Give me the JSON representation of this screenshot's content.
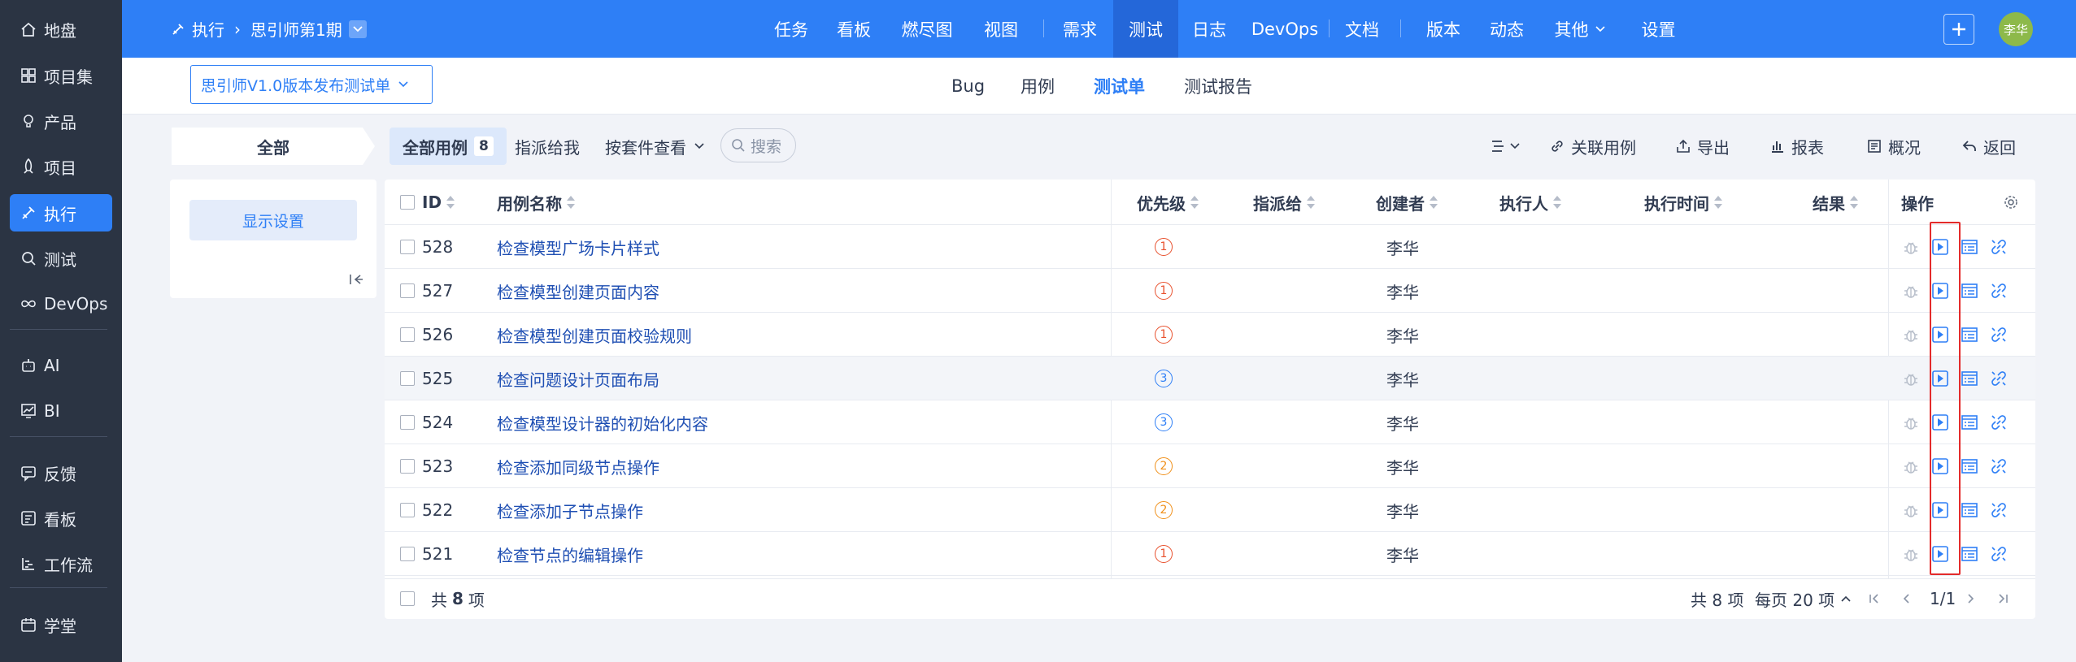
{
  "sidebar": {
    "items": [
      {
        "label": "地盘",
        "icon": "home-icon"
      },
      {
        "label": "项目集",
        "icon": "grid-icon"
      },
      {
        "label": "产品",
        "icon": "lightbulb-icon"
      },
      {
        "label": "项目",
        "icon": "rocket-icon"
      },
      {
        "label": "执行",
        "icon": "pen-icon",
        "active": true
      },
      {
        "label": "测试",
        "icon": "search-icon"
      },
      {
        "label": "DevOps",
        "icon": "infinity-icon"
      },
      {
        "label": "AI",
        "icon": "robot-icon"
      },
      {
        "label": "BI",
        "icon": "chart-icon"
      },
      {
        "label": "反馈",
        "icon": "feedback-icon"
      },
      {
        "label": "看板",
        "icon": "board-icon"
      },
      {
        "label": "工作流",
        "icon": "workflow-icon"
      },
      {
        "label": "学堂",
        "icon": "school-icon"
      }
    ]
  },
  "topbar": {
    "module": "执行",
    "execution": "思引师第1期",
    "nav": [
      "任务",
      "看板",
      "燃尽图",
      "视图",
      "需求",
      "测试",
      "日志",
      "DevOps",
      "文档",
      "版本",
      "动态",
      "其他",
      "设置"
    ],
    "active_nav": "测试",
    "user_avatar": "李华",
    "colors": {
      "primary": "#2e7ff6",
      "sidebar": "#2b3443"
    }
  },
  "subnav": {
    "testsheet": "思引师V1.0版本发布测试单",
    "tabs": [
      "Bug",
      "用例",
      "测试单",
      "测试报告"
    ],
    "active_tab": "测试单"
  },
  "toolbar": {
    "all": "全部",
    "all_cases": "全部用例",
    "all_cases_count": "8",
    "assigned_to_me": "指派给我",
    "by_suite": "按套件查看",
    "search_placeholder": "搜索",
    "link_case": "关联用例",
    "export": "导出",
    "report": "报表",
    "overview": "概况",
    "back": "返回"
  },
  "leftpanel": {
    "display_settings": "显示设置"
  },
  "table": {
    "columns": {
      "id": "ID",
      "title": "用例名称",
      "priority": "优先级",
      "assigned_to": "指派给",
      "creator": "创建者",
      "executor": "执行人",
      "exec_time": "执行时间",
      "result": "结果",
      "actions": "操作"
    },
    "rows": [
      {
        "id": "528",
        "title": "检查模型广场卡片样式",
        "priority": "1",
        "creator": "李华"
      },
      {
        "id": "527",
        "title": "检查模型创建页面内容",
        "priority": "1",
        "creator": "李华"
      },
      {
        "id": "526",
        "title": "检查模型创建页面校验规则",
        "priority": "1",
        "creator": "李华"
      },
      {
        "id": "525",
        "title": "检查问题设计页面布局",
        "priority": "3",
        "creator": "李华"
      },
      {
        "id": "524",
        "title": "检查模型设计器的初始化内容",
        "priority": "3",
        "creator": "李华"
      },
      {
        "id": "523",
        "title": "检查添加同级节点操作",
        "priority": "2",
        "creator": "李华"
      },
      {
        "id": "522",
        "title": "检查添加子节点操作",
        "priority": "2",
        "creator": "李华"
      },
      {
        "id": "521",
        "title": "检查节点的编辑操作",
        "priority": "1",
        "creator": "李华"
      }
    ],
    "priority_colors": {
      "1": "#e8512e",
      "2": "#f0901a",
      "3": "#2e7ff6"
    },
    "footer": {
      "total_prefix": "共",
      "total_count": "8",
      "total_suffix": "项",
      "total_right": "共 8 项",
      "per_page": "每页 20 项",
      "page": "1/1"
    }
  }
}
